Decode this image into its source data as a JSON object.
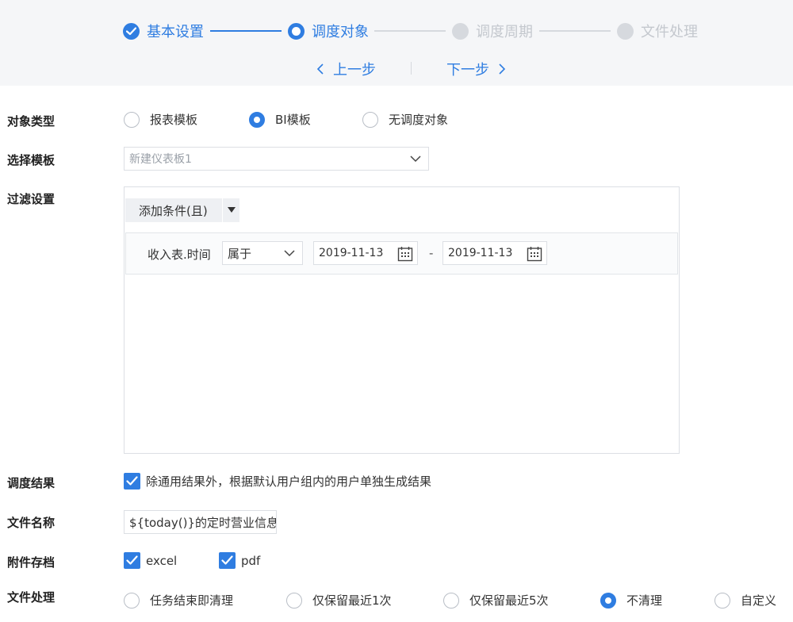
{
  "stepper": {
    "steps": [
      {
        "label": "基本设置",
        "state": "done"
      },
      {
        "label": "调度对象",
        "state": "active"
      },
      {
        "label": "调度周期",
        "state": "pending"
      },
      {
        "label": "文件处理",
        "state": "pending"
      }
    ],
    "prev_label": "上一步",
    "next_label": "下一步"
  },
  "colors": {
    "accent": "#2f7de1",
    "pending": "#d6d9de",
    "header_bg": "#f5f6f8"
  },
  "object_type": {
    "label": "对象类型",
    "options": [
      "报表模板",
      "BI模板",
      "无调度对象"
    ],
    "selected": "BI模板"
  },
  "template": {
    "label": "选择模板",
    "value": "新建仪表板1"
  },
  "filter": {
    "label": "过滤设置",
    "add_condition_label": "添加条件(且)",
    "condition": {
      "field": "收入表.时间",
      "operator": "属于",
      "start_date": "2019-11-13",
      "separator": "-",
      "end_date": "2019-11-13"
    }
  },
  "schedule_result": {
    "label": "调度结果",
    "checkbox_label": "除通用结果外，根据默认用户组内的用户单独生成结果",
    "checked": true
  },
  "file_name": {
    "label": "文件名称",
    "value": "${today()}的定时营业信息"
  },
  "attachment": {
    "label": "附件存档",
    "options": [
      {
        "label": "excel",
        "checked": true
      },
      {
        "label": "pdf",
        "checked": true
      }
    ]
  },
  "file_handling": {
    "label": "文件处理",
    "options": [
      "任务结束即清理",
      "仅保留最近1次",
      "仅保留最近5次",
      "不清理",
      "自定义"
    ],
    "selected": "不清理"
  }
}
